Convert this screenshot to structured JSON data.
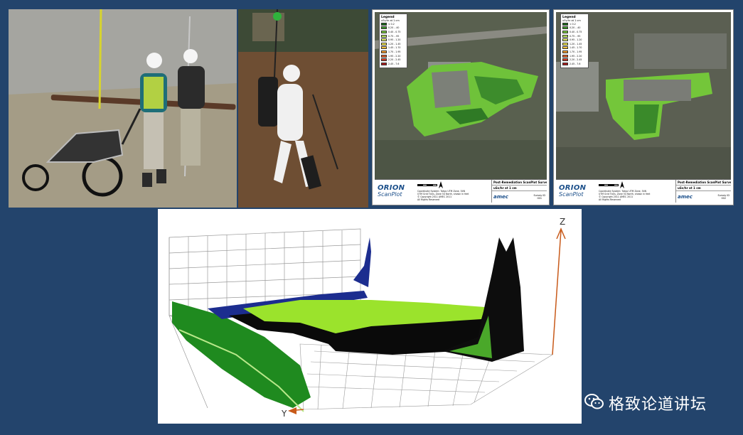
{
  "maps": [
    {
      "legend_title": "Legend",
      "legend_subtitle": "uSv/hr at 1 cm",
      "legend_items": [
        {
          "label": "< 0.2",
          "color": "#1d6b1d"
        },
        {
          "label": "0.20 - .40",
          "color": "#3e9a2a"
        },
        {
          "label": "0.40 - 0.75",
          "color": "#77c93a"
        },
        {
          "label": "0.75 - .95",
          "color": "#b7e05a"
        },
        {
          "label": "0.95 - 1.20",
          "color": "#e3ef6a"
        },
        {
          "label": "1.20 - 1.45",
          "color": "#f5e84f"
        },
        {
          "label": "1.45 - 1.70",
          "color": "#f6c33a"
        },
        {
          "label": "1.70 - 1.95",
          "color": "#f29a2c"
        },
        {
          "label": "1.95 - 2.20",
          "color": "#e4602a"
        },
        {
          "label": "2.20 - 2.45",
          "color": "#d63a26"
        },
        {
          "label": "2.45 - 7.6",
          "color": "#b01b1b"
        }
      ],
      "brand_top": "ORION",
      "brand_bottom": "ScanPlot",
      "survey_title": "Post-Remediation ScanPlot Survey",
      "units_label": "uSv/hr at 1 cm",
      "notes": [
        "Coordinate System: Tokyo UTM Zone, 54N",
        "UTM Grid Ticks, Zone 54 North, shown in feet",
        "© Copyright 2011 AMEC 2011",
        "All Rights Reserved"
      ],
      "logo": "amec",
      "survey_id_label": "Survey ID",
      "survey_id_value": "001"
    },
    {
      "legend_title": "Legend",
      "legend_subtitle": "uSv/hr at 1 cm",
      "legend_items": [
        {
          "label": "< 0.2",
          "color": "#1d6b1d"
        },
        {
          "label": "0.20 - .40",
          "color": "#3e9a2a"
        },
        {
          "label": "0.40 - 0.75",
          "color": "#77c93a"
        },
        {
          "label": "0.75 - .95",
          "color": "#b7e05a"
        },
        {
          "label": "0.95 - 1.20",
          "color": "#e3ef6a"
        },
        {
          "label": "1.20 - 1.45",
          "color": "#f5e84f"
        },
        {
          "label": "1.45 - 1.70",
          "color": "#f6c33a"
        },
        {
          "label": "1.70 - 1.95",
          "color": "#f29a2c"
        },
        {
          "label": "1.95 - 2.20",
          "color": "#e4602a"
        },
        {
          "label": "2.20 - 2.45",
          "color": "#d63a26"
        },
        {
          "label": "2.45 - 7.6",
          "color": "#b01b1b"
        }
      ],
      "brand_top": "ORION",
      "brand_bottom": "ScanPlot",
      "survey_title": "Post-Remediation ScanPlot Survey",
      "units_label": "uSv/hr at 1 cm",
      "notes": [
        "Coordinate System: Tokyo UTM Zone, 54N",
        "UTM Grid Ticks, Zone 54 North, shown in feet",
        "© Copyright 2011 AMEC 2011",
        "All Rights Reserved"
      ],
      "logo": "amec",
      "survey_id_label": "Survey ID",
      "survey_id_value": "002"
    }
  ],
  "plot3d": {
    "axis_z_label": "Z",
    "axis_y_label": "Y"
  },
  "watermark": {
    "text": "格致论道讲坛",
    "icon": "wechat-icon"
  },
  "colors": {
    "background": "#23446c",
    "ground_green": "#7fdc2a",
    "dark_green": "#1f8a1f",
    "blue_points": "#1c2d8f",
    "axis_orange": "#c85a1a"
  }
}
